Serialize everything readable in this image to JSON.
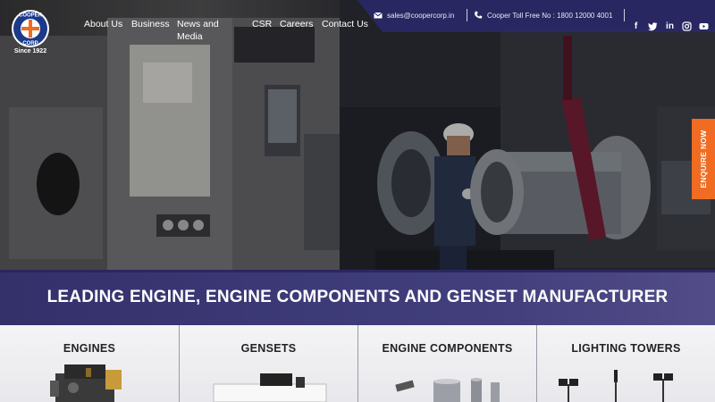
{
  "brand": {
    "logo_text_top": "COOPER",
    "logo_text_bottom": "CORP",
    "since": "Since 1922",
    "logo_colors": {
      "ring": "#1b3a8a",
      "cross": "#f06c22"
    }
  },
  "nav": [
    {
      "label": "About Us"
    },
    {
      "label": "Business"
    },
    {
      "label": "News and",
      "label2": "Media"
    },
    {
      "label": "CSR"
    },
    {
      "label": "Careers"
    },
    {
      "label": "Contact Us"
    }
  ],
  "topbar": {
    "email": "sales@coopercorp.in",
    "email_icon": "envelope-icon",
    "phone": "Cooper Toll Free No : 1800 12000 4001",
    "phone_icon": "phone-icon",
    "bg_color": "#2a2866"
  },
  "social": [
    {
      "icon": "facebook-icon",
      "glyph": "f"
    },
    {
      "icon": "twitter-icon",
      "glyph": "t"
    },
    {
      "icon": "linkedin-icon",
      "glyph": "in"
    },
    {
      "icon": "instagram-icon",
      "glyph": "◎"
    },
    {
      "icon": "youtube-icon",
      "glyph": "▶"
    }
  ],
  "enquire": {
    "label": "ENQUIRE NOW",
    "color": "#f06c22"
  },
  "banner": {
    "title": "LEADING ENGINE, ENGINE COMPONENTS AND GENSET MANUFACTURER"
  },
  "categories": [
    {
      "name": "ENGINES"
    },
    {
      "name": "GENSETS"
    },
    {
      "name": "ENGINE COMPONENTS"
    },
    {
      "name": "LIGHTING TOWERS"
    }
  ]
}
